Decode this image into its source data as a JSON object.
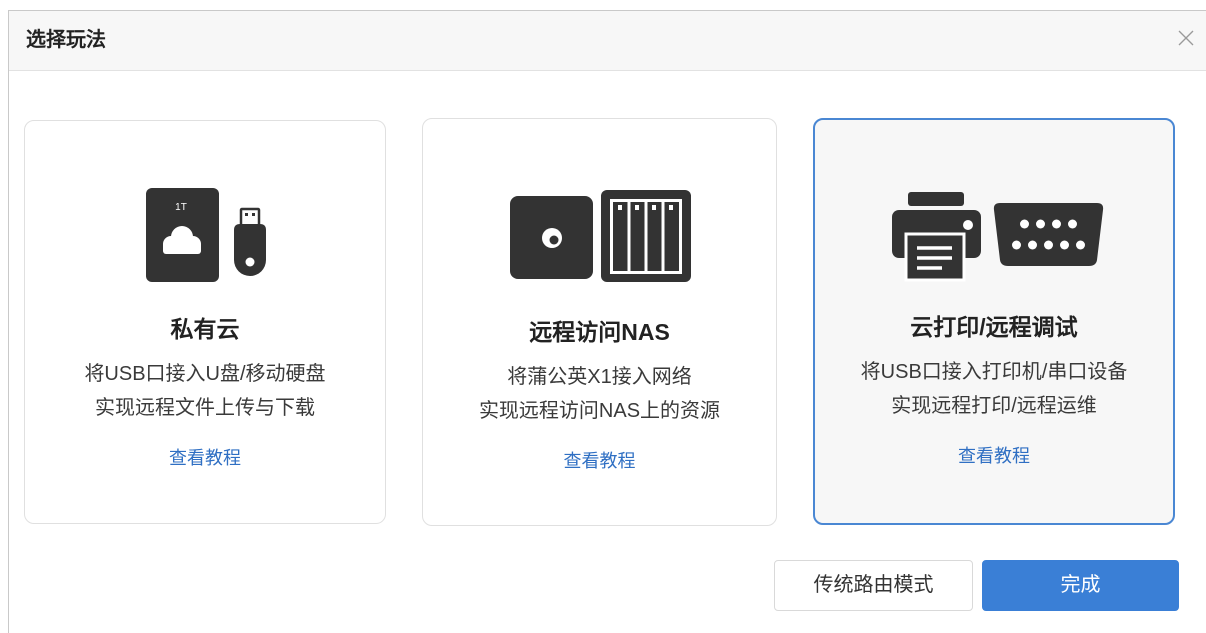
{
  "dialog": {
    "title": "选择玩法",
    "close_icon": "close-icon"
  },
  "selected_card_index": 2,
  "cards": [
    {
      "icons": [
        "storage-box-icon",
        "usb-drive-icon"
      ],
      "device_label": "1T",
      "title": "私有云",
      "desc_lines": [
        "将USB口接入U盘/移动硬盘",
        "实现远程文件上传与下载"
      ],
      "link_label": "查看教程"
    },
    {
      "icons": [
        "power-box-icon",
        "nas-icon"
      ],
      "title": "远程访问NAS",
      "desc_lines": [
        "将蒲公英X1接入网络",
        "实现远程访问NAS上的资源"
      ],
      "link_label": "查看教程"
    },
    {
      "icons": [
        "printer-icon",
        "serial-port-icon"
      ],
      "title": "云打印/远程调试",
      "desc_lines": [
        "将USB口接入打印机/串口设备",
        "实现远程打印/远程运维"
      ],
      "link_label": "查看教程"
    }
  ],
  "footer": {
    "router_mode_label": "传统路由模式",
    "done_label": "完成"
  },
  "colors": {
    "accent": "#3a7fd6",
    "link": "#2f6fc3",
    "icon": "#333333",
    "selected_border": "#4a87d3",
    "selected_bg": "#f7f7f7"
  }
}
